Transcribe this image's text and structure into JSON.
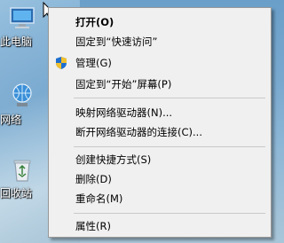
{
  "desktop": {
    "icons": [
      {
        "label": "此电脑",
        "icon": "computer-icon"
      },
      {
        "label": "网络",
        "icon": "network-icon"
      },
      {
        "label": "回收站",
        "icon": "recycle-bin-icon"
      }
    ]
  },
  "context_menu": {
    "items": [
      {
        "label": "打开(O)",
        "bold": true
      },
      {
        "label": "固定到“快速访问”"
      },
      {
        "label": "管理(G)",
        "icon": "uac-shield-icon"
      },
      {
        "label": "固定到“开始”屏幕(P)"
      },
      {
        "label": "映射网络驱动器(N)..."
      },
      {
        "label": "断开网络驱动器的连接(C)..."
      },
      {
        "label": "创建快捷方式(S)"
      },
      {
        "label": "删除(D)"
      },
      {
        "label": "重命名(M)"
      },
      {
        "label": "属性(R)"
      }
    ]
  },
  "colors": {
    "menu_background": "#f0f0f0",
    "menu_border": "#979797",
    "separator": "#c9c9c9"
  }
}
